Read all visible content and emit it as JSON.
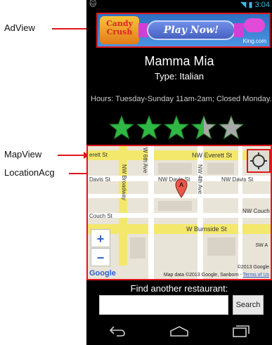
{
  "annotations": {
    "adview": "AdView",
    "mapview": "MapView",
    "location": "LocationAcg"
  },
  "status": {
    "time": "3:04"
  },
  "ad": {
    "brand": "Candy Crush",
    "button": "Play Now!",
    "site": "King.com"
  },
  "restaurant": {
    "name": "Mamma Mia",
    "type": "Type: Italian",
    "hours": "Hours: Tuesday-Sunday 11am-2am; Closed Monday.",
    "rating": 3.5,
    "rating_max": 5
  },
  "map": {
    "streets": {
      "everett_left": "erett St",
      "everett_right": "NW Everett St",
      "davis_left": "Davis St",
      "davis_mid": "NW Davis St",
      "davis_right": "NW Davis St",
      "couch_left": "Couch St",
      "couch_right": "NW Couch St",
      "burnside": "W Burnside St",
      "broadway": "NW Broadway",
      "ave6": "W 6th Ave",
      "ave4": "NW 4th Ave",
      "swa": "SW A"
    },
    "marker_letter": "A",
    "zoom_in": "+",
    "zoom_out": "−",
    "logo": "Google",
    "copyright": "©2013 Google",
    "credit": "Map data ©2013 Google, Sanborn -",
    "terms": "Terms of Us"
  },
  "search": {
    "heading": "Find another restaurant:",
    "value": "",
    "button": "Search"
  },
  "colors": {
    "annotation_red": "#e0151b",
    "star_green": "#2fb843",
    "star_gray": "#a8a8a8"
  },
  "icons": {
    "back": "back-icon",
    "home": "home-icon",
    "recent": "recent-apps-icon",
    "location": "crosshair-icon"
  }
}
